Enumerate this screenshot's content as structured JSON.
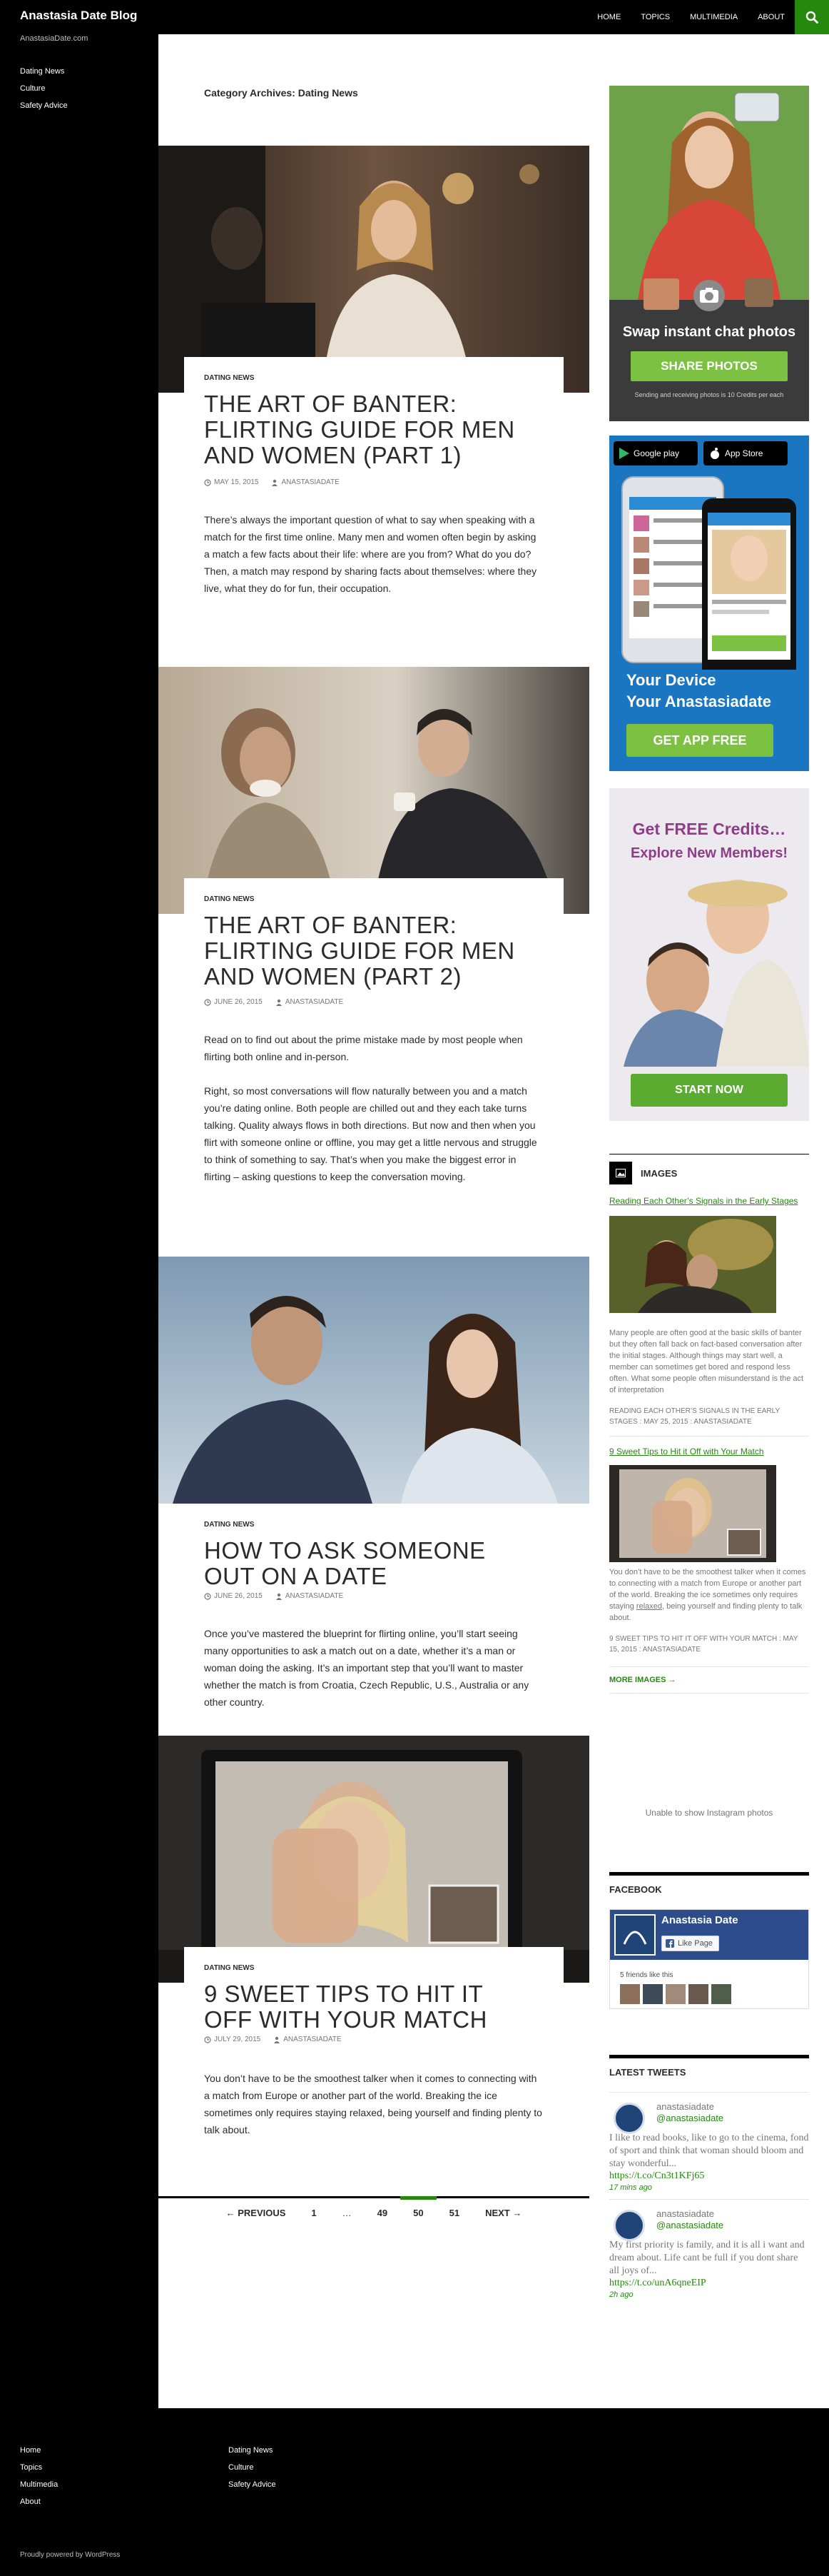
{
  "header": {
    "site_title": "Anastasia Date Blog",
    "nav": [
      "HOME",
      "TOPICS",
      "MULTIMEDIA",
      "ABOUT"
    ]
  },
  "left_sidebar": {
    "site_description": "AnastasiaDate.com",
    "nav": [
      "Dating News",
      "Culture",
      "Safety Advice"
    ]
  },
  "archive_title": "Category Archives: Dating News",
  "posts": [
    {
      "category": "DATING NEWS",
      "title": "THE ART OF BANTER: FLIRTING GUIDE FOR MEN AND WOMEN (PART 1)",
      "date": "MAY 15, 2015",
      "author": "ANASTASIADATE",
      "summary": [
        "There’s always the important question of what to say when speaking with a match for the first time online. Many men and women often begin by asking a match a few facts about their life: where are you from? What do you do? Then, a match may respond by sharing facts about themselves: where they live, what they do for fun, their occupation."
      ]
    },
    {
      "category": "DATING NEWS",
      "title": "THE ART OF BANTER: FLIRTING GUIDE FOR MEN AND WOMEN (PART 2)",
      "date": "JUNE 26, 2015",
      "author": "ANASTASIADATE",
      "summary": [
        "Read on to find out about the prime mistake made by most people when flirting both online and in-person.",
        "Right, so most conversations will flow naturally between you and a match you’re dating online. Both people are chilled out and they each take turns talking. Quality always flows in both directions. But now and then when you flirt with someone online or offline, you may get a little nervous and struggle to think of something to say. That’s when you make the biggest error in flirting – asking questions to keep the conversation moving."
      ]
    },
    {
      "category": "DATING NEWS",
      "title": "HOW TO ASK SOMEONE OUT ON A DATE",
      "date": "JUNE 26, 2015",
      "author": "ANASTASIADATE",
      "summary": [
        "Once you’ve mastered the blueprint for flirting online, you’ll start seeing many opportunities to ask a match out on a date, whether it’s a man or woman doing the asking. It’s an important step that you’ll want to master whether the match is from Croatia, Czech Republic, U.S., Australia or any other country."
      ]
    },
    {
      "category": "DATING NEWS",
      "title": "9 SWEET TIPS TO HIT IT OFF WITH YOUR MATCH",
      "date": "JULY 29, 2015",
      "author": "ANASTASIADATE",
      "summary": [
        "You don’t have to be the smoothest talker when it comes to connecting with a match from Europe or another part of the world. Breaking the ice sometimes only requires staying relaxed, being yourself and finding plenty to talk about."
      ]
    }
  ],
  "pagination": {
    "previous": "← PREVIOUS",
    "pages": [
      "1",
      "…",
      "49",
      "50",
      "51"
    ],
    "current": "50",
    "next": "NEXT →"
  },
  "ads": {
    "ad1": {
      "headline": "Swap instant chat photos",
      "button": "SHARE PHOTOS",
      "fine_print": "Sending and receiving photos is 10 Credits per each"
    },
    "ad2": {
      "store1": "Google play",
      "store2": "App Store",
      "headline_line1": "Your Device",
      "headline_line2": "Your Anastasiadate",
      "button": "GET APP FREE"
    },
    "ad3": {
      "headline": "Get FREE Credits…",
      "subheadline": "Explore New Members!",
      "button": "START NOW"
    }
  },
  "images_widget": {
    "title": "IMAGES",
    "items": [
      {
        "link": "Reading Each Other’s Signals in the Early Stages",
        "text": "Many people are often good at the basic skills of banter but they often fall back on fact-based conversation after the initial stages. Although things may start well, a member can sometimes get bored and respond less often. What some people often misunderstand is the act of interpretation",
        "meta": "READING EACH OTHER’S SIGNALS IN THE EARLY STAGES : MAY 25, 2015 : ANASTASIADATE"
      },
      {
        "link": "9 Sweet Tips to Hit it Off with Your Match",
        "text_before": "You don’t have to be the smoothest talker when it comes to connecting with a match from Europe or another part of the world. Breaking the ice sometimes only requires staying ",
        "text_link": "relaxed",
        "text_after": ", being yourself and finding plenty to talk about.",
        "meta": "9 SWEET TIPS TO HIT IT OFF WITH YOUR MATCH : MAY 15, 2015 : ANASTASIADATE"
      }
    ],
    "more": "MORE IMAGES →",
    "instagram_note": "Unable to show Instagram photos"
  },
  "facebook_widget": {
    "title": "FACEBOOK",
    "page_name": "Anastasia Date",
    "like_button": "Like Page",
    "friends_text": "5 friends like this"
  },
  "tweets_widget": {
    "title": "LATEST TWEETS",
    "tweets": [
      {
        "name": "anastasiadate",
        "handle": "@anastasiadate",
        "text": "I like to read books, like to go to the cinema, fond of sport and think that woman should bloom and stay wonderful...",
        "link": "https://t.co/Cn3t1KFj65",
        "time": "17 mins ago"
      },
      {
        "name": "anastasiadate",
        "handle": "@anastasiadate",
        "text": "My first priority is family, and it is all i want and dream about. Life cant be full if you dont share all joys of...",
        "link": "https://t.co/unA6qneEIP",
        "time": "2h ago"
      }
    ]
  },
  "footer": {
    "col1": [
      "Home",
      "Topics",
      "Multimedia",
      "About"
    ],
    "col2": [
      "Dating News",
      "Culture",
      "Safety Advice"
    ],
    "powered": "Proudly powered by WordPress"
  },
  "colors": {
    "accent": "#24890d",
    "black": "#000000",
    "text": "#2b2b2b",
    "muted": "#767676"
  }
}
